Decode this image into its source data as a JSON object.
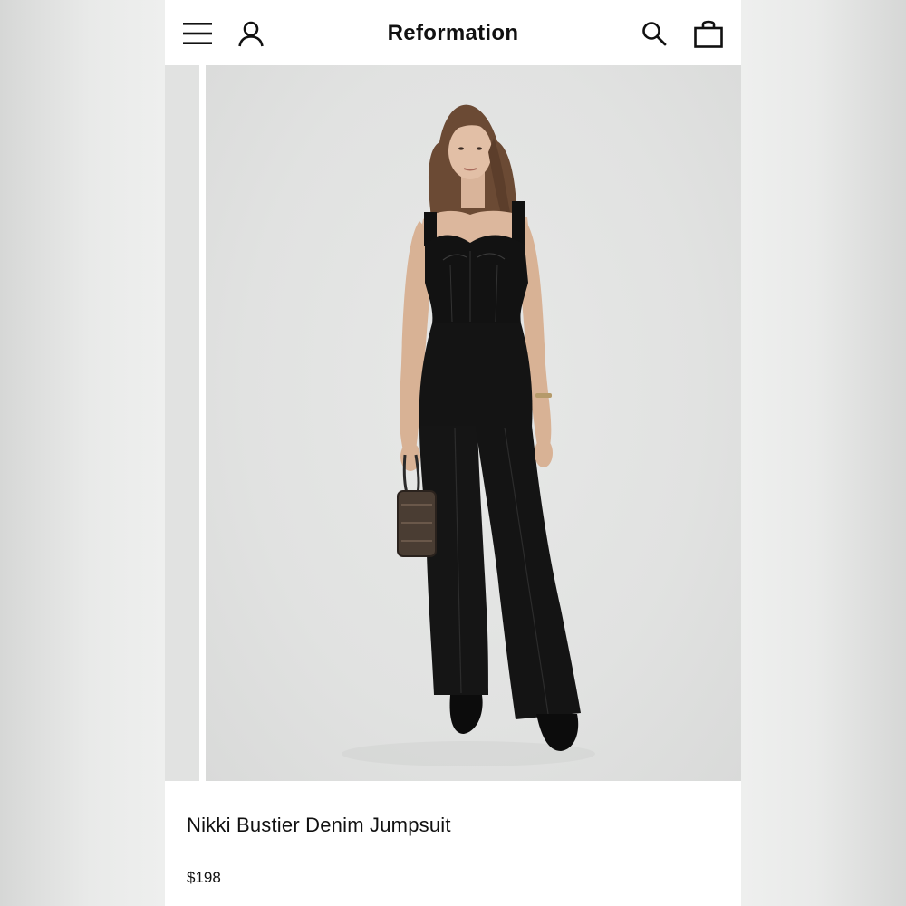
{
  "header": {
    "brand": "Reformation",
    "icons": [
      "menu-icon",
      "account-icon",
      "search-icon",
      "shopping-bag-icon"
    ]
  },
  "product": {
    "name": "Nikki Bustier Denim Jumpsuit",
    "price": "$198"
  },
  "colors": {
    "page_background": "#eeefee",
    "image_background": "#e1e2e1",
    "text": "#111111"
  }
}
